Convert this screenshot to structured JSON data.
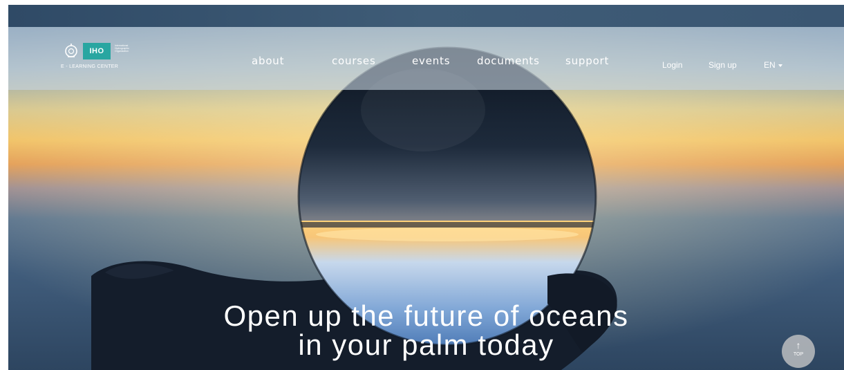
{
  "logo": {
    "box_text": "IHO",
    "small_lines": [
      "International",
      "Hydrographic",
      "Organization"
    ],
    "subtitle": "E - LEARNING CENTER"
  },
  "nav": {
    "links": [
      "about",
      "courses",
      "events",
      "documents",
      "support"
    ],
    "login": "Login",
    "signup": "Sign up",
    "language": "EN"
  },
  "hero": {
    "headline_line1": "Open up the future of oceans",
    "headline_line2": "in your palm today"
  },
  "top_button": {
    "arrow": "↑",
    "label": "TOP"
  },
  "colors": {
    "logo_accent": "#29a6a1",
    "top_strip": "#3a5672"
  },
  "icons": [
    "iho-emblem-icon",
    "caret-down-icon",
    "arrow-up-icon"
  ]
}
